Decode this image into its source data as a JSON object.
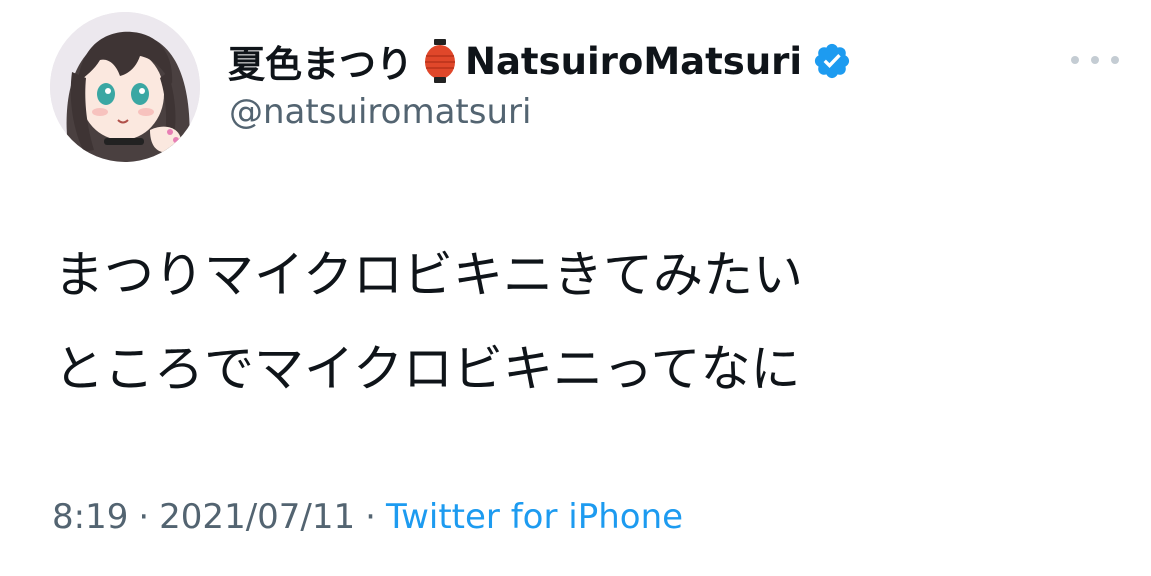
{
  "user": {
    "display_name": "夏色まつり",
    "lantern_icon": "lantern-icon",
    "display_name_en": "NatsuiroMatsuri",
    "verified_icon": "verified-badge-icon",
    "handle": "@natsuiromatsuri",
    "avatar": "avatar"
  },
  "tweet": {
    "lines": [
      "まつりマイクロビキニきてみたい",
      "ところでマイクロビキニってなに"
    ],
    "time": "8:19",
    "separator": "·",
    "date": "2021/07/11",
    "source": "Twitter for iPhone"
  },
  "actions": {
    "more_icon": "more-options-icon"
  },
  "colors": {
    "text": "#0f1419",
    "secondary": "#536471",
    "link": "#1d9bf0",
    "verified": "#1d9bf0",
    "lantern": "#e0472a"
  }
}
